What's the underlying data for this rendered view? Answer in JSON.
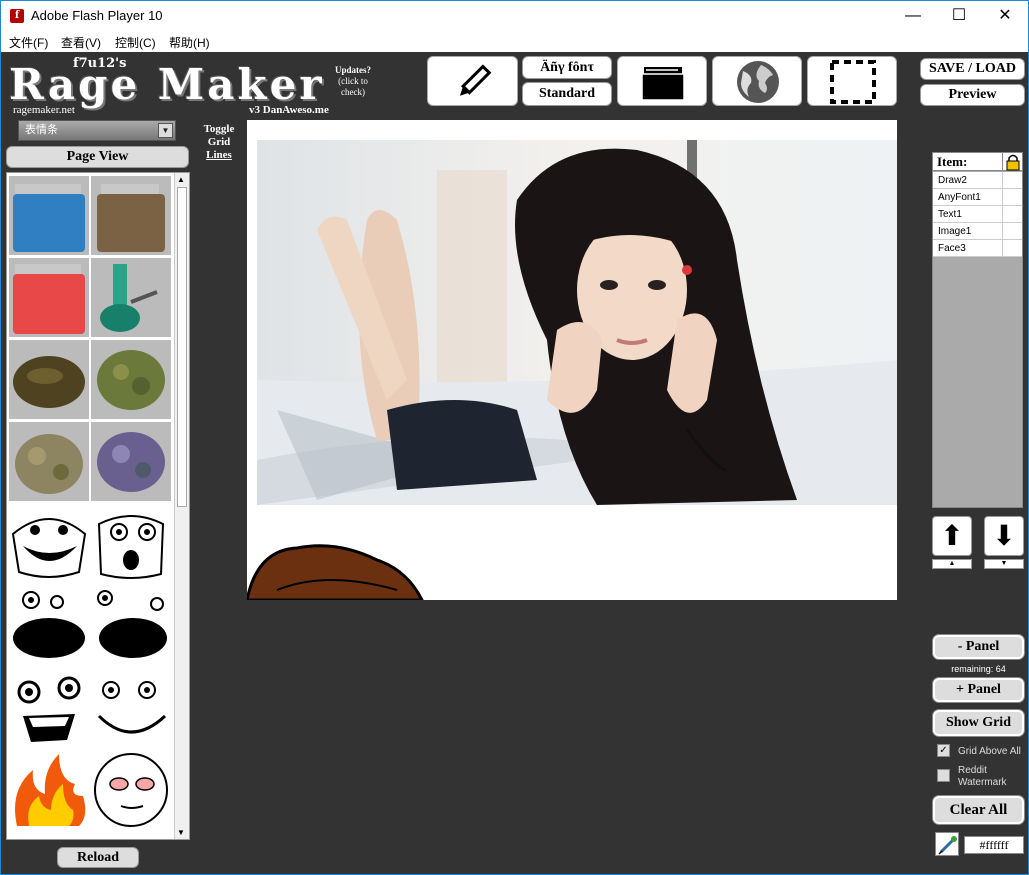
{
  "window": {
    "title": "Adobe Flash Player 10",
    "minimize": "—",
    "maximize": "☐",
    "close": "✕"
  },
  "menu": [
    "文件(F)",
    "查看(V)",
    "控制(C)",
    "帮助(H)"
  ],
  "logo": {
    "author": "f7u12's",
    "title": "Rage Maker",
    "site": "ragemaker.net",
    "version": "v3  DanAweso.me"
  },
  "updates": {
    "title": "Updates?",
    "sub1": "(click to",
    "sub2": "check)"
  },
  "tools": {
    "font_label": "Äñγ fônτ",
    "standard_label": "Standard",
    "save_load": "SAVE / LOAD",
    "preview": "Preview"
  },
  "left": {
    "dropdown": "表情条",
    "page_view": "Page View",
    "reload": "Reload"
  },
  "toggle_grid": [
    "Toggle",
    "Grid",
    "Lines"
  ],
  "items": {
    "header": "Item:",
    "list": [
      "Draw2",
      "AnyFont1",
      "Text1",
      "Image1",
      "Face3"
    ]
  },
  "right": {
    "minus_panel": "- Panel",
    "remaining": "remaining: 64",
    "plus_panel": "+ Panel",
    "show_grid": "Show Grid",
    "grid_above_all": "Grid Above All",
    "reddit_watermark_1": "Reddit",
    "reddit_watermark_2": "Watermark",
    "clear_all": "Clear All",
    "color_hex": "#ffffff"
  },
  "checkboxes": {
    "grid_above_all": true,
    "reddit_watermark": false
  }
}
